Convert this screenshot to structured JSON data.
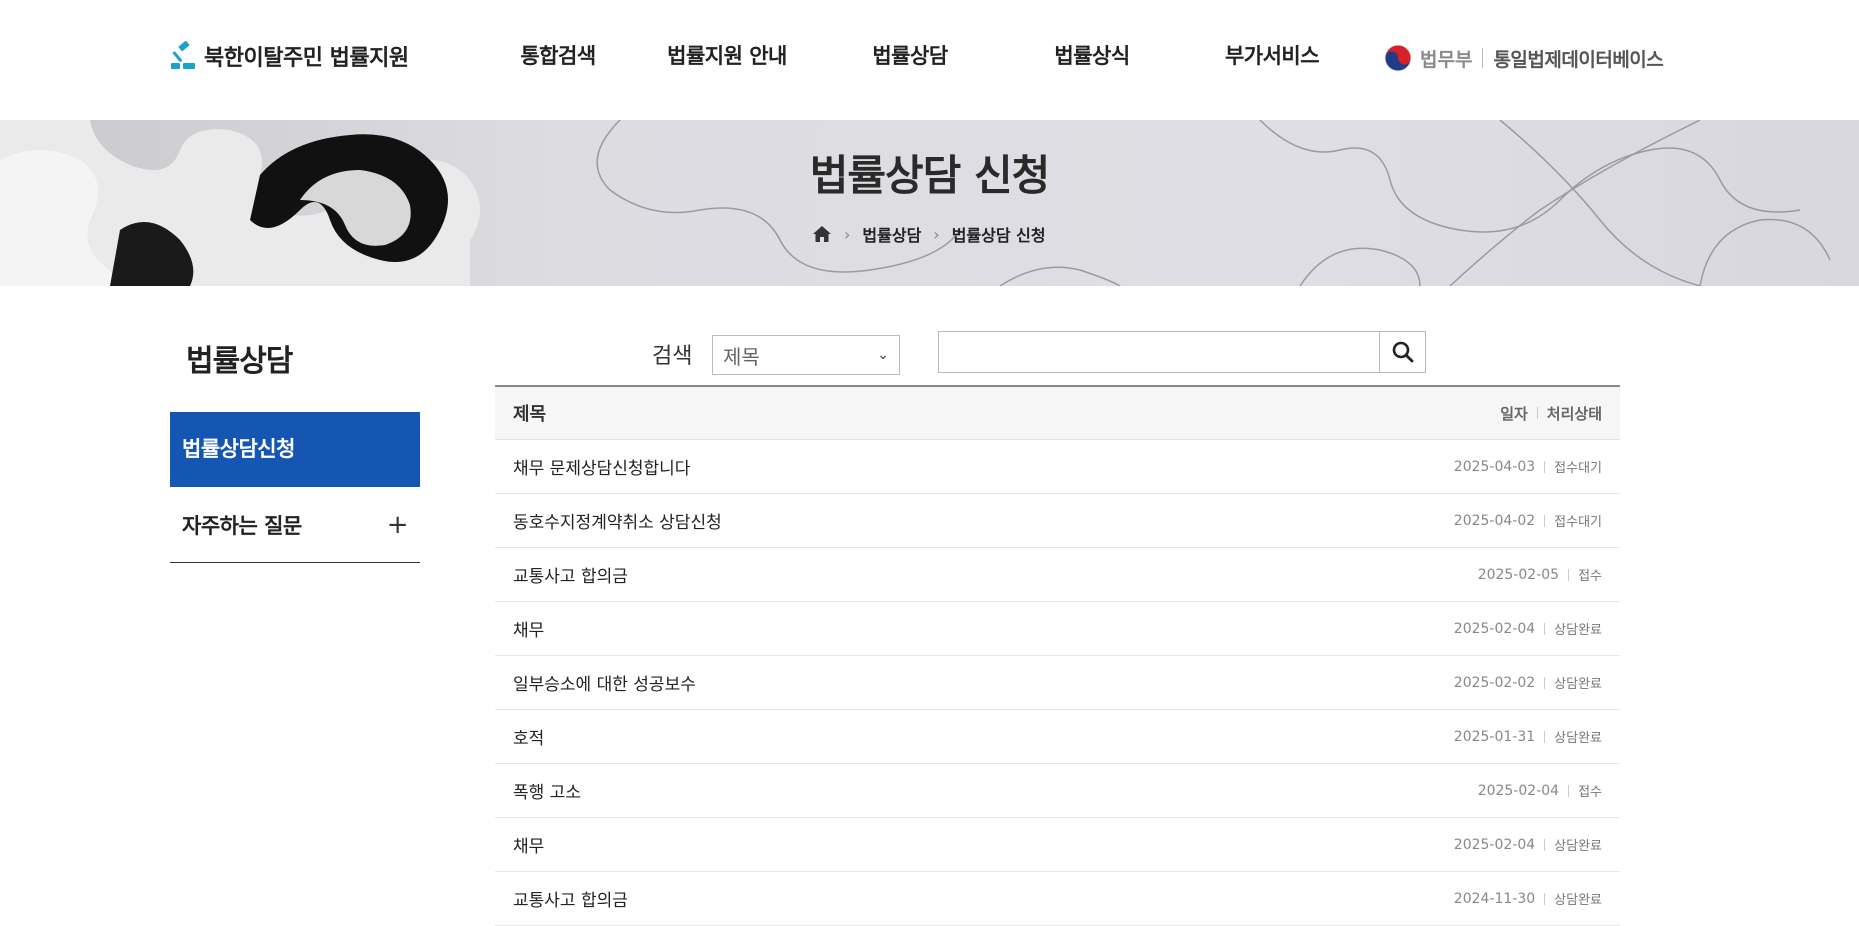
{
  "header": {
    "logo_text": "북한이탈주민 법률지원",
    "nav": [
      "통합검색",
      "법률지원 안내",
      "법률상담",
      "법률상식",
      "부가서비스"
    ],
    "ministry": "법무부",
    "db_link": "통일법제데이터베이스"
  },
  "banner": {
    "title": "법률상담 신청",
    "breadcrumb": [
      "법률상담",
      "법률상담 신청"
    ]
  },
  "sidebar": {
    "title": "법률상담",
    "items": [
      {
        "label": "법률상담신청",
        "active": true
      },
      {
        "label": "자주하는 질문",
        "expand_icon": "+"
      }
    ]
  },
  "search": {
    "label": "검색",
    "select_value": "제목",
    "query": "",
    "chevron": "⌄"
  },
  "board": {
    "header": {
      "title": "제목",
      "date": "일자",
      "status": "처리상태"
    },
    "rows": [
      {
        "title": "채무 문제상담신청합니다",
        "date": "2025-04-03",
        "status": "접수대기"
      },
      {
        "title": "동호수지정계약취소 상담신청",
        "date": "2025-04-02",
        "status": "접수대기"
      },
      {
        "title": "교통사고 합의금",
        "date": "2025-02-05",
        "status": "접수"
      },
      {
        "title": "채무",
        "date": "2025-02-04",
        "status": "상담완료"
      },
      {
        "title": "일부승소에 대한 성공보수",
        "date": "2025-02-02",
        "status": "상담완료"
      },
      {
        "title": "호적",
        "date": "2025-01-31",
        "status": "상담완료"
      },
      {
        "title": "폭행 고소",
        "date": "2025-02-04",
        "status": "접수"
      },
      {
        "title": "채무",
        "date": "2025-02-04",
        "status": "상담완료"
      },
      {
        "title": "교통사고 합의금",
        "date": "2024-11-30",
        "status": "상담완료"
      }
    ]
  },
  "colors": {
    "accent": "#1556b3",
    "logo_teal": "#1aa3c9",
    "banner_bg": "#dcdce1"
  }
}
